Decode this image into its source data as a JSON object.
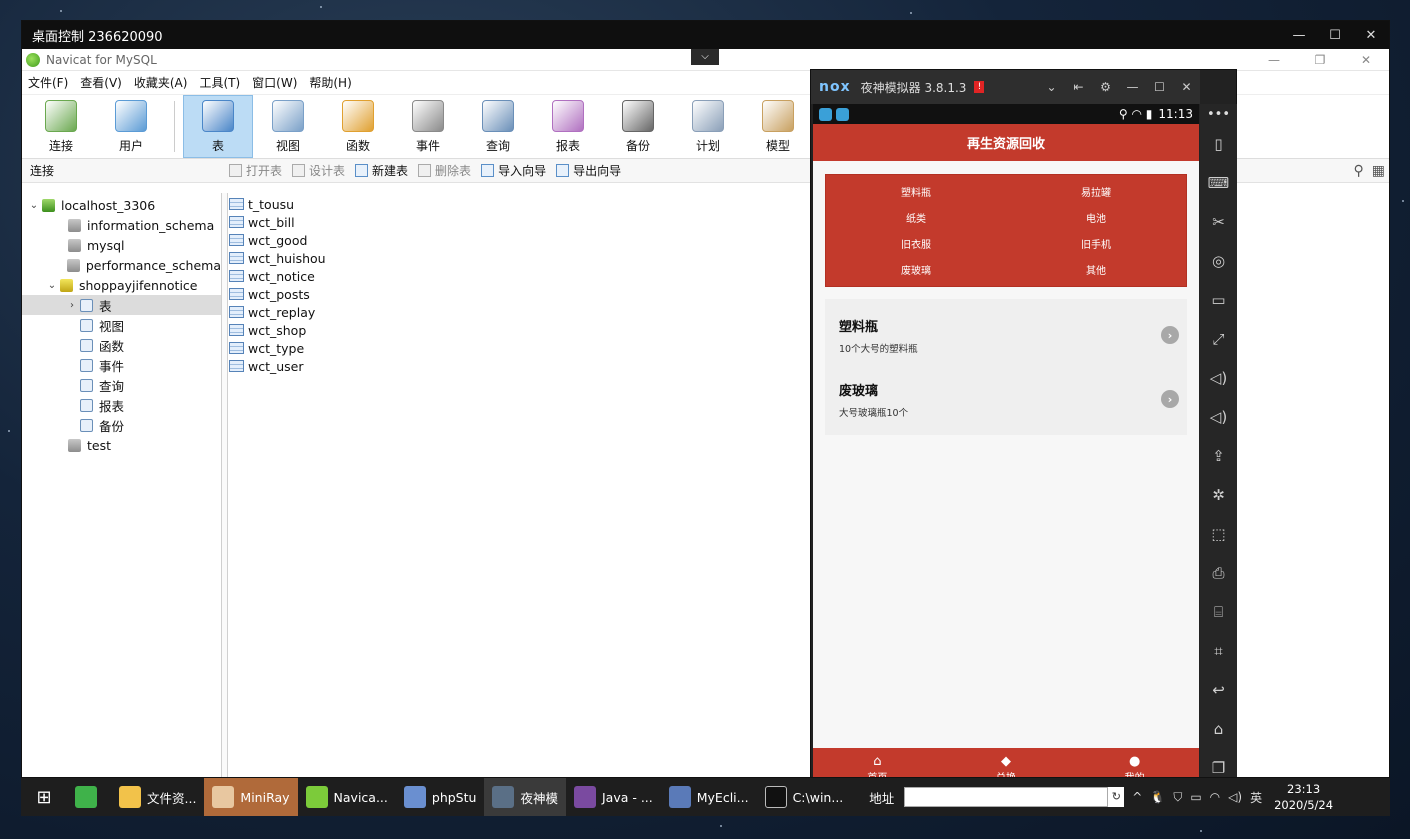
{
  "remote": {
    "title": "桌面控制 236620090",
    "ctrl_min": "—",
    "ctrl_max": "☐",
    "ctrl_close": "✕"
  },
  "navicat": {
    "title": "Navicat for MySQL",
    "dropdown_glyph": "⌵",
    "ctrl_min": "—",
    "ctrl_restore": "❐",
    "ctrl_close": "✕",
    "menu": [
      "文件(F)",
      "查看(V)",
      "收藏夹(A)",
      "工具(T)",
      "窗口(W)",
      "帮助(H)"
    ],
    "toolbar": [
      {
        "label": "连接",
        "icon": "connection-icon",
        "color": "#6aa84f"
      },
      {
        "label": "用户",
        "icon": "user-icon",
        "color": "#5b9bd5"
      },
      {
        "label": "表",
        "icon": "table-icon",
        "color": "#4a86c8",
        "active": true
      },
      {
        "label": "视图",
        "icon": "view-icon",
        "color": "#7aa0c8"
      },
      {
        "label": "函数",
        "icon": "function-icon",
        "color": "#e0a030"
      },
      {
        "label": "事件",
        "icon": "event-icon",
        "color": "#8a8a8a"
      },
      {
        "label": "查询",
        "icon": "query-icon",
        "color": "#6a8fb8"
      },
      {
        "label": "报表",
        "icon": "report-icon",
        "color": "#b070c0"
      },
      {
        "label": "备份",
        "icon": "backup-icon",
        "color": "#666666"
      },
      {
        "label": "计划",
        "icon": "schedule-icon",
        "color": "#8a9fb8"
      },
      {
        "label": "模型",
        "icon": "model-icon",
        "color": "#c8a060"
      }
    ],
    "connection_label": "连接",
    "obj_actions": [
      {
        "label": "打开表",
        "enabled": false
      },
      {
        "label": "设计表",
        "enabled": false
      },
      {
        "label": "新建表",
        "enabled": true
      },
      {
        "label": "删除表",
        "enabled": false
      },
      {
        "label": "导入向导",
        "enabled": true
      },
      {
        "label": "导出向导",
        "enabled": true
      }
    ],
    "search_glyph": "⚲",
    "grid_glyph": "▦",
    "tree": {
      "host": "localhost_3306",
      "databases_before": [
        "information_schema",
        "mysql",
        "performance_schema"
      ],
      "open_db": "shoppayjifennotice",
      "open_db_children": [
        {
          "label": "表",
          "icon": "table-icon"
        },
        {
          "label": "视图",
          "icon": "view-icon"
        },
        {
          "label": "函数",
          "icon": "function-icon"
        },
        {
          "label": "事件",
          "icon": "event-icon"
        },
        {
          "label": "查询",
          "icon": "query-icon"
        },
        {
          "label": "报表",
          "icon": "report-icon"
        },
        {
          "label": "备份",
          "icon": "backup-icon"
        }
      ],
      "databases_after": [
        "test"
      ]
    },
    "tables": [
      "t_tousu",
      "wct_bill",
      "wct_good",
      "wct_huishou",
      "wct_notice",
      "wct_posts",
      "wct_replay",
      "wct_shop",
      "wct_type",
      "wct_user"
    ]
  },
  "nox": {
    "brand": "nox",
    "title": "夜神模拟器 3.8.1.3",
    "badge": "!",
    "ctrls": [
      "⌄",
      "⇤",
      "⚙",
      "—",
      "☐",
      "✕"
    ],
    "side_more": "•••",
    "side_buttons": [
      "▯",
      "⌨",
      "✂",
      "◎",
      "▭",
      "⤢",
      "◁)",
      "◁)",
      "⇪",
      "✲",
      "⬚",
      "⎙",
      "⌸",
      "⌗",
      "↩",
      "⌂",
      "❐"
    ],
    "status_time": "11:13",
    "status_icons": "⚲ ◠ ▮",
    "app": {
      "header": "再生资源回收",
      "categories": [
        "塑料瓶",
        "易拉罐",
        "纸类",
        "电池",
        "旧衣服",
        "旧手机",
        "废玻璃",
        "其他"
      ],
      "items": [
        {
          "title": "塑料瓶",
          "desc": "10个大号的塑料瓶"
        },
        {
          "title": "废玻璃",
          "desc": "大号玻璃瓶10个"
        }
      ],
      "chevron": "›",
      "tabs": [
        {
          "label": "首页",
          "icon": "⌂"
        },
        {
          "label": "兑换",
          "icon": "◆"
        },
        {
          "label": "我的",
          "icon": "●"
        }
      ]
    }
  },
  "taskbar": {
    "start_glyph": "⊞",
    "items": [
      {
        "label": "",
        "icon": "media-player-icon",
        "color": "#3fb24a"
      },
      {
        "label": "文件资...",
        "icon": "file-explorer-icon",
        "color": "#f2c24a"
      },
      {
        "label": "MiniRay",
        "icon": "miniray-icon",
        "color": "#e8c7a0"
      },
      {
        "label": "Navica...",
        "icon": "navicat-icon",
        "color": "#7ccb3a"
      },
      {
        "label": "phpStu",
        "icon": "phpstudy-icon",
        "color": "#6a8fd0"
      },
      {
        "label": "夜神模",
        "icon": "nox-icon",
        "color": "#5a6f86"
      },
      {
        "label": "Java - ...",
        "icon": "eclipse-icon",
        "color": "#7a4aa0"
      },
      {
        "label": "MyEcli...",
        "icon": "myeclipse-icon",
        "color": "#5a7ab8"
      },
      {
        "label": "C:\\win...",
        "icon": "cmd-icon",
        "color": "#111111"
      }
    ],
    "address_label": "地址",
    "address_value": "",
    "address_go": "↻",
    "tray": [
      "^",
      "🐧",
      "⛉",
      "▭",
      "◠",
      "◁)",
      "英"
    ],
    "time": "23:13",
    "date": "2020/5/24"
  }
}
